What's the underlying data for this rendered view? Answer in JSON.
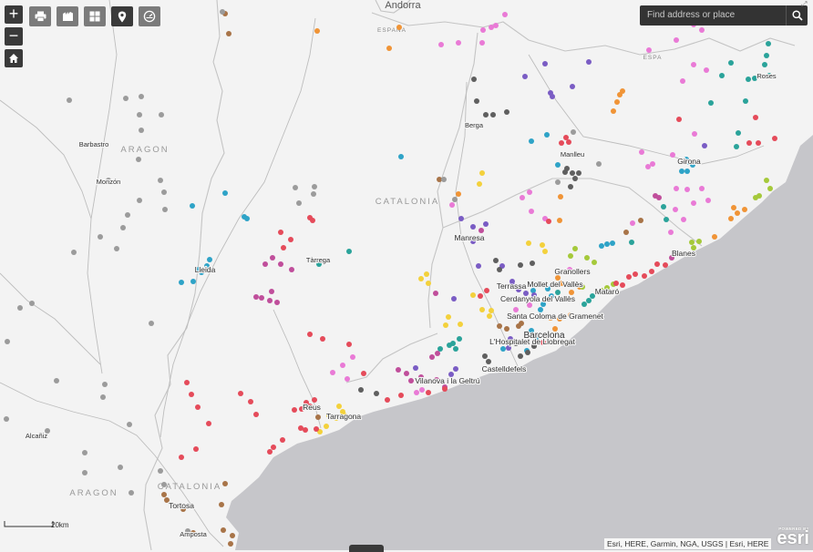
{
  "toolbar": {
    "zoom_in": "+",
    "zoom_out": "−",
    "tools": [
      {
        "name": "print-icon"
      },
      {
        "name": "basemap-icon"
      },
      {
        "name": "layers-grid-icon"
      },
      {
        "name": "location-pin-icon"
      },
      {
        "name": "measure-icon"
      }
    ]
  },
  "search": {
    "placeholder": "Find address or place"
  },
  "attribution": "Esri, HERE, Garmin, NGA, USGS | Esri, HERE",
  "logo": {
    "powered": "POWERED BY",
    "name": "esri"
  },
  "scale": {
    "label": "20km"
  },
  "map_labels": {
    "andorra": "Andorra",
    "espana_n": "ESPAÑA",
    "espana_ne": "ESPA",
    "aragon_n": "ARAGON",
    "aragon_s": "ARAGON",
    "catalonia_c": "CATALONIA",
    "catalonia_s": "CATALONIA",
    "barbastro": "Barbastro",
    "monzon": "Monzón",
    "lleida": "Lleida",
    "tarrega": "Tàrrega",
    "alcaniz": "Alcañiz",
    "tortosa": "Tortosa",
    "amposta": "Amposta",
    "reus": "Reus",
    "tarragona": "Tarragona",
    "berga": "Berga",
    "manlleu": "Manlleu",
    "manresa": "Manresa",
    "girona": "Girona",
    "roses": "Roses",
    "blanes": "Blanes",
    "granollers": "Granollers",
    "mataro": "Mataró",
    "terrassa": "Terrassa",
    "mollet": "Mollet del Vallès",
    "cerdanyola": "Cerdanyola del Vallès",
    "santa_coloma": "Santa Coloma de Gramenet",
    "barcelona": "Barcelona",
    "hospitalet": "L'Hospitalet de Llobregat",
    "castelldefels": "Castelldefels",
    "vilanova": "Vilanova i la Geltrú"
  },
  "colors": {
    "land": "#f3f3f3",
    "sea": "#c6c6ca",
    "boundary": "#c4c4c4",
    "river": "#bdbdbd",
    "control_bg": "#3a3a3a"
  },
  "palette": [
    "#2ea3c7",
    "#e54b5a",
    "#7a5cc4",
    "#f09436",
    "#9b9b9b",
    "#2aa39a",
    "#a5c93a",
    "#e97ad6",
    "#c04e9b",
    "#f3d13c",
    "#a87448",
    "#5f5f5f"
  ],
  "points": [
    [
      247,
      15,
      10
    ],
    [
      251,
      37,
      10
    ],
    [
      348,
      34,
      3
    ],
    [
      244,
      13,
      4
    ],
    [
      427,
      53,
      3
    ],
    [
      438,
      30,
      3
    ],
    [
      539,
      30,
      7
    ],
    [
      544,
      28,
      7
    ],
    [
      530,
      33,
      7
    ],
    [
      484,
      49,
      7
    ],
    [
      503,
      47,
      7
    ],
    [
      529,
      47,
      7
    ],
    [
      554,
      16,
      7
    ],
    [
      520,
      87,
      11
    ],
    [
      523,
      111,
      11
    ],
    [
      533,
      126,
      11
    ],
    [
      541,
      126,
      11
    ],
    [
      556,
      123,
      11
    ],
    [
      598,
      70,
      2
    ],
    [
      576,
      84,
      2
    ],
    [
      604,
      102,
      2
    ],
    [
      606,
      106,
      2
    ],
    [
      628,
      95,
      2
    ],
    [
      646,
      68,
      2
    ],
    [
      673,
      122,
      3
    ],
    [
      677,
      112,
      3
    ],
    [
      680,
      104,
      3
    ],
    [
      683,
      100,
      3
    ],
    [
      761,
      27,
      7
    ],
    [
      770,
      33,
      7
    ],
    [
      742,
      44,
      7
    ],
    [
      712,
      55,
      7
    ],
    [
      761,
      71,
      7
    ],
    [
      775,
      77,
      7
    ],
    [
      749,
      89,
      7
    ],
    [
      802,
      69,
      5
    ],
    [
      792,
      83,
      5
    ],
    [
      821,
      87,
      5
    ],
    [
      828,
      86,
      5
    ],
    [
      844,
      83,
      5
    ],
    [
      843,
      48,
      5
    ],
    [
      841,
      61,
      5
    ],
    [
      839,
      71,
      5
    ],
    [
      780,
      113,
      5
    ],
    [
      745,
      131,
      1
    ],
    [
      829,
      129,
      1
    ],
    [
      832,
      157,
      1
    ],
    [
      850,
      152,
      1
    ],
    [
      822,
      157,
      1
    ],
    [
      810,
      146,
      5
    ],
    [
      808,
      161,
      5
    ],
    [
      818,
      111,
      5
    ],
    [
      773,
      160,
      2
    ],
    [
      621,
      151,
      1
    ],
    [
      616,
      157,
      1
    ],
    [
      624,
      156,
      1
    ],
    [
      583,
      155,
      0
    ],
    [
      600,
      148,
      0
    ],
    [
      612,
      181,
      0
    ],
    [
      620,
      189,
      11
    ],
    [
      628,
      190,
      11
    ],
    [
      635,
      190,
      11
    ],
    [
      626,
      205,
      11
    ],
    [
      631,
      196,
      11
    ],
    [
      622,
      185,
      11
    ],
    [
      704,
      167,
      7
    ],
    [
      711,
      183,
      7
    ],
    [
      716,
      180,
      7
    ],
    [
      738,
      170,
      7
    ],
    [
      762,
      147,
      7
    ],
    [
      753,
      175,
      0
    ],
    [
      756,
      178,
      0
    ],
    [
      760,
      181,
      0
    ],
    [
      719,
      215,
      8
    ],
    [
      723,
      217,
      8
    ],
    [
      748,
      188,
      0
    ],
    [
      754,
      188,
      0
    ],
    [
      742,
      207,
      7
    ],
    [
      754,
      208,
      7
    ],
    [
      770,
      207,
      7
    ],
    [
      777,
      220,
      7
    ],
    [
      761,
      223,
      7
    ],
    [
      741,
      230,
      7
    ],
    [
      750,
      241,
      7
    ],
    [
      736,
      255,
      7
    ],
    [
      728,
      227,
      5
    ],
    [
      731,
      241,
      5
    ],
    [
      694,
      245,
      7
    ],
    [
      660,
      270,
      0
    ],
    [
      666,
      268,
      0
    ],
    [
      672,
      267,
      0
    ],
    [
      687,
      255,
      10
    ],
    [
      703,
      242,
      10
    ],
    [
      693,
      266,
      5
    ],
    [
      805,
      228,
      3
    ],
    [
      809,
      234,
      3
    ],
    [
      817,
      230,
      3
    ],
    [
      802,
      240,
      3
    ],
    [
      841,
      198,
      6
    ],
    [
      845,
      207,
      6
    ],
    [
      829,
      217,
      6
    ],
    [
      833,
      215,
      6
    ],
    [
      759,
      266,
      6
    ],
    [
      767,
      265,
      6
    ],
    [
      761,
      272,
      6
    ],
    [
      784,
      260,
      3
    ],
    [
      737,
      283,
      8
    ],
    [
      730,
      291,
      1
    ],
    [
      721,
      290,
      1
    ],
    [
      715,
      298,
      1
    ],
    [
      707,
      303,
      1
    ],
    [
      581,
      211,
      7
    ],
    [
      583,
      232,
      7
    ],
    [
      573,
      217,
      7
    ],
    [
      598,
      240,
      7
    ],
    [
      602,
      243,
      1
    ],
    [
      614,
      242,
      3
    ],
    [
      615,
      216,
      3
    ],
    [
      529,
      190,
      9
    ],
    [
      526,
      202,
      9
    ],
    [
      482,
      197,
      10
    ],
    [
      503,
      213,
      3
    ],
    [
      506,
      240,
      2
    ],
    [
      519,
      249,
      2
    ],
    [
      533,
      246,
      2
    ],
    [
      519,
      265,
      2
    ],
    [
      528,
      253,
      8
    ],
    [
      496,
      225,
      7
    ],
    [
      595,
      269,
      9
    ],
    [
      598,
      276,
      9
    ],
    [
      580,
      267,
      9
    ],
    [
      462,
      306,
      9
    ],
    [
      468,
      301,
      9
    ],
    [
      470,
      311,
      9
    ],
    [
      525,
      292,
      2
    ],
    [
      551,
      292,
      2
    ],
    [
      562,
      309,
      2
    ],
    [
      498,
      328,
      2
    ],
    [
      478,
      322,
      8
    ],
    [
      492,
      348,
      9
    ],
    [
      489,
      357,
      9
    ],
    [
      505,
      356,
      9
    ],
    [
      519,
      324,
      9
    ],
    [
      534,
      319,
      1
    ],
    [
      527,
      325,
      1
    ],
    [
      544,
      286,
      11
    ],
    [
      548,
      296,
      11
    ],
    [
      571,
      291,
      11
    ],
    [
      584,
      289,
      11
    ],
    [
      626,
      281,
      6
    ],
    [
      644,
      283,
      6
    ],
    [
      652,
      288,
      6
    ],
    [
      631,
      273,
      6
    ],
    [
      612,
      305,
      3
    ],
    [
      625,
      296,
      7
    ],
    [
      601,
      317,
      0
    ],
    [
      605,
      325,
      0
    ],
    [
      585,
      319,
      0
    ],
    [
      612,
      321,
      5
    ],
    [
      596,
      334,
      0
    ],
    [
      562,
      313,
      2
    ],
    [
      569,
      318,
      2
    ],
    [
      577,
      322,
      2
    ],
    [
      586,
      324,
      2
    ],
    [
      620,
      328,
      3
    ],
    [
      627,
      321,
      3
    ],
    [
      636,
      315,
      3
    ],
    [
      616,
      311,
      3
    ],
    [
      639,
      315,
      6
    ],
    [
      646,
      330,
      5
    ],
    [
      641,
      334,
      5
    ],
    [
      650,
      325,
      5
    ],
    [
      660,
      319,
      6
    ],
    [
      666,
      316,
      6
    ],
    [
      673,
      312,
      6
    ],
    [
      676,
      311,
      1
    ],
    [
      683,
      313,
      1
    ],
    [
      690,
      304,
      1
    ],
    [
      697,
      301,
      1
    ],
    [
      529,
      340,
      9
    ],
    [
      539,
      341,
      9
    ],
    [
      537,
      347,
      9
    ],
    [
      560,
      347,
      9
    ],
    [
      566,
      340,
      7
    ],
    [
      581,
      335,
      7
    ],
    [
      548,
      358,
      10
    ],
    [
      556,
      361,
      10
    ],
    [
      569,
      358,
      10
    ],
    [
      572,
      355,
      10
    ],
    [
      593,
      340,
      0
    ],
    [
      604,
      349,
      3
    ],
    [
      609,
      361,
      3
    ],
    [
      599,
      369,
      3
    ],
    [
      614,
      350,
      3
    ],
    [
      626,
      346,
      3
    ],
    [
      583,
      363,
      0
    ],
    [
      588,
      371,
      0
    ],
    [
      575,
      376,
      0
    ],
    [
      578,
      385,
      0
    ],
    [
      596,
      376,
      1
    ],
    [
      566,
      377,
      11
    ],
    [
      571,
      391,
      11
    ],
    [
      579,
      387,
      11
    ],
    [
      586,
      380,
      11
    ],
    [
      560,
      372,
      2
    ],
    [
      558,
      382,
      2
    ],
    [
      504,
      372,
      5
    ],
    [
      497,
      377,
      5
    ],
    [
      483,
      383,
      5
    ],
    [
      493,
      379,
      5
    ],
    [
      500,
      383,
      5
    ],
    [
      474,
      392,
      8
    ],
    [
      480,
      388,
      8
    ],
    [
      532,
      391,
      11
    ],
    [
      536,
      397,
      11
    ],
    [
      552,
      383,
      0
    ],
    [
      495,
      411,
      2
    ],
    [
      500,
      405,
      2
    ],
    [
      479,
      417,
      8
    ],
    [
      488,
      425,
      8
    ],
    [
      462,
      414,
      8
    ],
    [
      451,
      418,
      8
    ],
    [
      457,
      431,
      7
    ],
    [
      463,
      428,
      7
    ],
    [
      470,
      431,
      1
    ],
    [
      488,
      427,
      1
    ],
    [
      440,
      434,
      1
    ],
    [
      425,
      439,
      1
    ],
    [
      413,
      432,
      11
    ],
    [
      396,
      428,
      11
    ],
    [
      437,
      406,
      8
    ],
    [
      446,
      410,
      8
    ],
    [
      456,
      404,
      2
    ],
    [
      399,
      410,
      1
    ],
    [
      381,
      416,
      7
    ],
    [
      365,
      409,
      7
    ],
    [
      376,
      401,
      7
    ],
    [
      383,
      378,
      1
    ],
    [
      372,
      446,
      9
    ],
    [
      376,
      452,
      9
    ],
    [
      378,
      456,
      9
    ],
    [
      369,
      459,
      9
    ],
    [
      361,
      456,
      9
    ],
    [
      349,
      458,
      10
    ],
    [
      351,
      474,
      9
    ],
    [
      358,
      468,
      9
    ],
    [
      345,
      439,
      1
    ],
    [
      336,
      442,
      1
    ],
    [
      340,
      446,
      1
    ],
    [
      331,
      449,
      1
    ],
    [
      330,
      470,
      1
    ],
    [
      335,
      472,
      1
    ],
    [
      347,
      471,
      1
    ],
    [
      323,
      450,
      1
    ],
    [
      300,
      491,
      1
    ],
    [
      296,
      496,
      1
    ],
    [
      310,
      483,
      1
    ],
    [
      227,
      292,
      0
    ],
    [
      218,
      296,
      0
    ],
    [
      221,
      299,
      0
    ],
    [
      229,
      297,
      0
    ],
    [
      212,
      309,
      0
    ],
    [
      199,
      310,
      0
    ],
    [
      230,
      285,
      0
    ],
    [
      211,
      226,
      0
    ],
    [
      247,
      212,
      0
    ],
    [
      268,
      238,
      0
    ],
    [
      271,
      240,
      0
    ],
    [
      340,
      239,
      1
    ],
    [
      343,
      242,
      1
    ],
    [
      308,
      255,
      1
    ],
    [
      319,
      263,
      1
    ],
    [
      311,
      272,
      1
    ],
    [
      299,
      283,
      8
    ],
    [
      291,
      290,
      8
    ],
    [
      308,
      290,
      8
    ],
    [
      320,
      296,
      8
    ],
    [
      298,
      320,
      8
    ],
    [
      296,
      330,
      8
    ],
    [
      287,
      327,
      8
    ],
    [
      281,
      326,
      8
    ],
    [
      304,
      332,
      8
    ],
    [
      350,
      290,
      5
    ],
    [
      383,
      276,
      5
    ],
    [
      340,
      367,
      1
    ],
    [
      354,
      372,
      1
    ],
    [
      387,
      392,
      7
    ],
    [
      217,
      447,
      1
    ],
    [
      229,
      465,
      1
    ],
    [
      210,
      433,
      1
    ],
    [
      205,
      420,
      1
    ],
    [
      264,
      432,
      1
    ],
    [
      275,
      441,
      1
    ],
    [
      281,
      455,
      1
    ],
    [
      215,
      493,
      1
    ],
    [
      199,
      502,
      1
    ],
    [
      180,
      543,
      10
    ],
    [
      183,
      549,
      10
    ],
    [
      201,
      559,
      10
    ],
    [
      247,
      531,
      10
    ],
    [
      243,
      554,
      10
    ],
    [
      212,
      585,
      10
    ],
    [
      245,
      582,
      10
    ],
    [
      255,
      588,
      10
    ],
    [
      253,
      597,
      10
    ],
    [
      206,
      583,
      4
    ],
    [
      138,
      108,
      4
    ],
    [
      155,
      106,
      4
    ],
    [
      153,
      126,
      4
    ],
    [
      177,
      126,
      4
    ],
    [
      155,
      143,
      4
    ],
    [
      152,
      175,
      4
    ],
    [
      176,
      198,
      4
    ],
    [
      180,
      211,
      4
    ],
    [
      119,
      198,
      4
    ],
    [
      153,
      220,
      4
    ],
    [
      140,
      236,
      4
    ],
    [
      135,
      250,
      4
    ],
    [
      110,
      260,
      4
    ],
    [
      128,
      273,
      4
    ],
    [
      76,
      110,
      4
    ],
    [
      181,
      230,
      4
    ],
    [
      35,
      333,
      4
    ],
    [
      22,
      338,
      4
    ],
    [
      81,
      277,
      4
    ],
    [
      166,
      355,
      4
    ],
    [
      115,
      422,
      4
    ],
    [
      113,
      436,
      4
    ],
    [
      62,
      418,
      4
    ],
    [
      52,
      473,
      4
    ],
    [
      93,
      497,
      4
    ],
    [
      93,
      519,
      4
    ],
    [
      142,
      466,
      4
    ],
    [
      132,
      513,
      4
    ],
    [
      144,
      541,
      4
    ],
    [
      176,
      517,
      4
    ],
    [
      180,
      532,
      4
    ],
    [
      8,
      375,
      4
    ],
    [
      7,
      460,
      4
    ],
    [
      324,
      206,
      4
    ],
    [
      328,
      223,
      4
    ],
    [
      345,
      205,
      4
    ],
    [
      344,
      213,
      4
    ],
    [
      440,
      172,
      0
    ],
    [
      487,
      197,
      4
    ],
    [
      499,
      219,
      4
    ],
    [
      629,
      145,
      4
    ],
    [
      657,
      180,
      4
    ],
    [
      612,
      200,
      4
    ]
  ]
}
